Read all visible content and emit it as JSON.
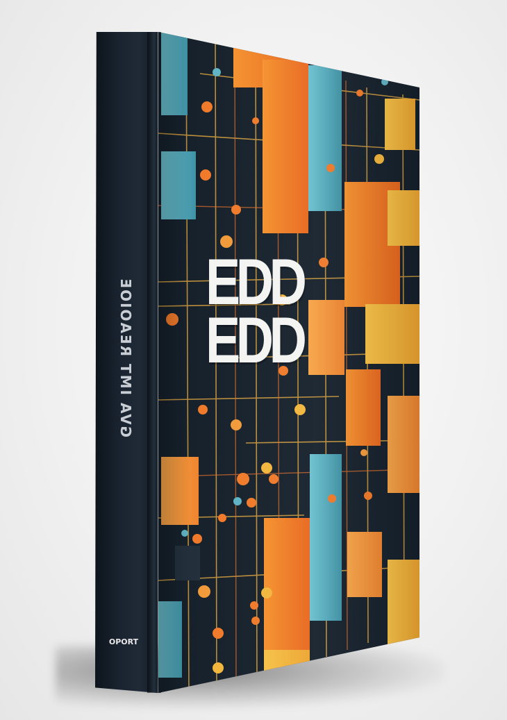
{
  "scene": {
    "subject": "book"
  },
  "book": {
    "spine_title": "GVA IMT REAOIOE",
    "spine_publisher": "OPORT",
    "cover_title_line1": "EDD",
    "cover_title_line2": "EDD"
  },
  "colors": {
    "background": "#f1f1f1",
    "cover_base": "#16212c",
    "orange": "#f07a2a",
    "light_orange": "#f29a3a",
    "yellow": "#f2b63c",
    "teal": "#5fb3c4",
    "line_gold": "#d8a23f",
    "title_white": "#f4f4f2"
  }
}
